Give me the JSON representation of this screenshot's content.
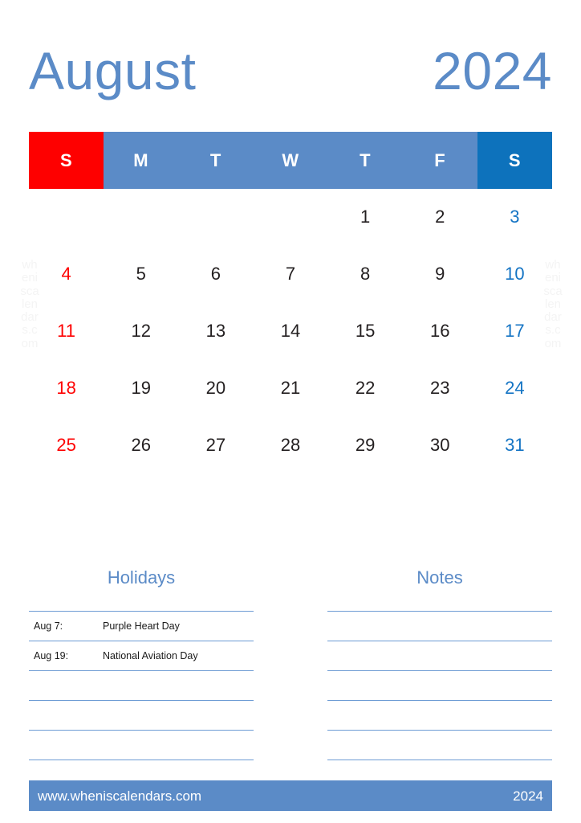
{
  "header": {
    "month": "August",
    "year": "2024"
  },
  "watermark": {
    "text": "wheniscalendars.com"
  },
  "calendar": {
    "weekday_labels": [
      "S",
      "M",
      "T",
      "W",
      "T",
      "F",
      "S"
    ],
    "weeks": [
      [
        "",
        "",
        "",
        "",
        "1",
        "2",
        "3"
      ],
      [
        "4",
        "5",
        "6",
        "7",
        "8",
        "9",
        "10"
      ],
      [
        "11",
        "12",
        "13",
        "14",
        "15",
        "16",
        "17"
      ],
      [
        "18",
        "19",
        "20",
        "21",
        "22",
        "23",
        "24"
      ],
      [
        "25",
        "26",
        "27",
        "28",
        "29",
        "30",
        "31"
      ]
    ],
    "colors": {
      "sunday_header_bg": "#fe0000",
      "weekday_header_bg": "#5b8bc7",
      "saturday_header_bg": "#0d72bc",
      "sunday_date": "#fe0000",
      "saturday_date": "#1474c4",
      "weekday_date": "#231f20",
      "title": "#5b8bc7",
      "rule_line": "#6d9bd4",
      "footer_bg": "#5b8bc7"
    }
  },
  "holidays": {
    "title": "Holidays",
    "entries": [
      {
        "date": "Aug 7:",
        "name": "Purple Heart Day"
      },
      {
        "date": "Aug 19:",
        "name": "National Aviation Day"
      },
      {
        "date": "",
        "name": ""
      },
      {
        "date": "",
        "name": ""
      },
      {
        "date": "",
        "name": ""
      }
    ]
  },
  "notes": {
    "title": "Notes",
    "entries": [
      "",
      "",
      "",
      "",
      ""
    ]
  },
  "footer": {
    "website": "www.wheniscalendars.com",
    "year": "2024"
  }
}
